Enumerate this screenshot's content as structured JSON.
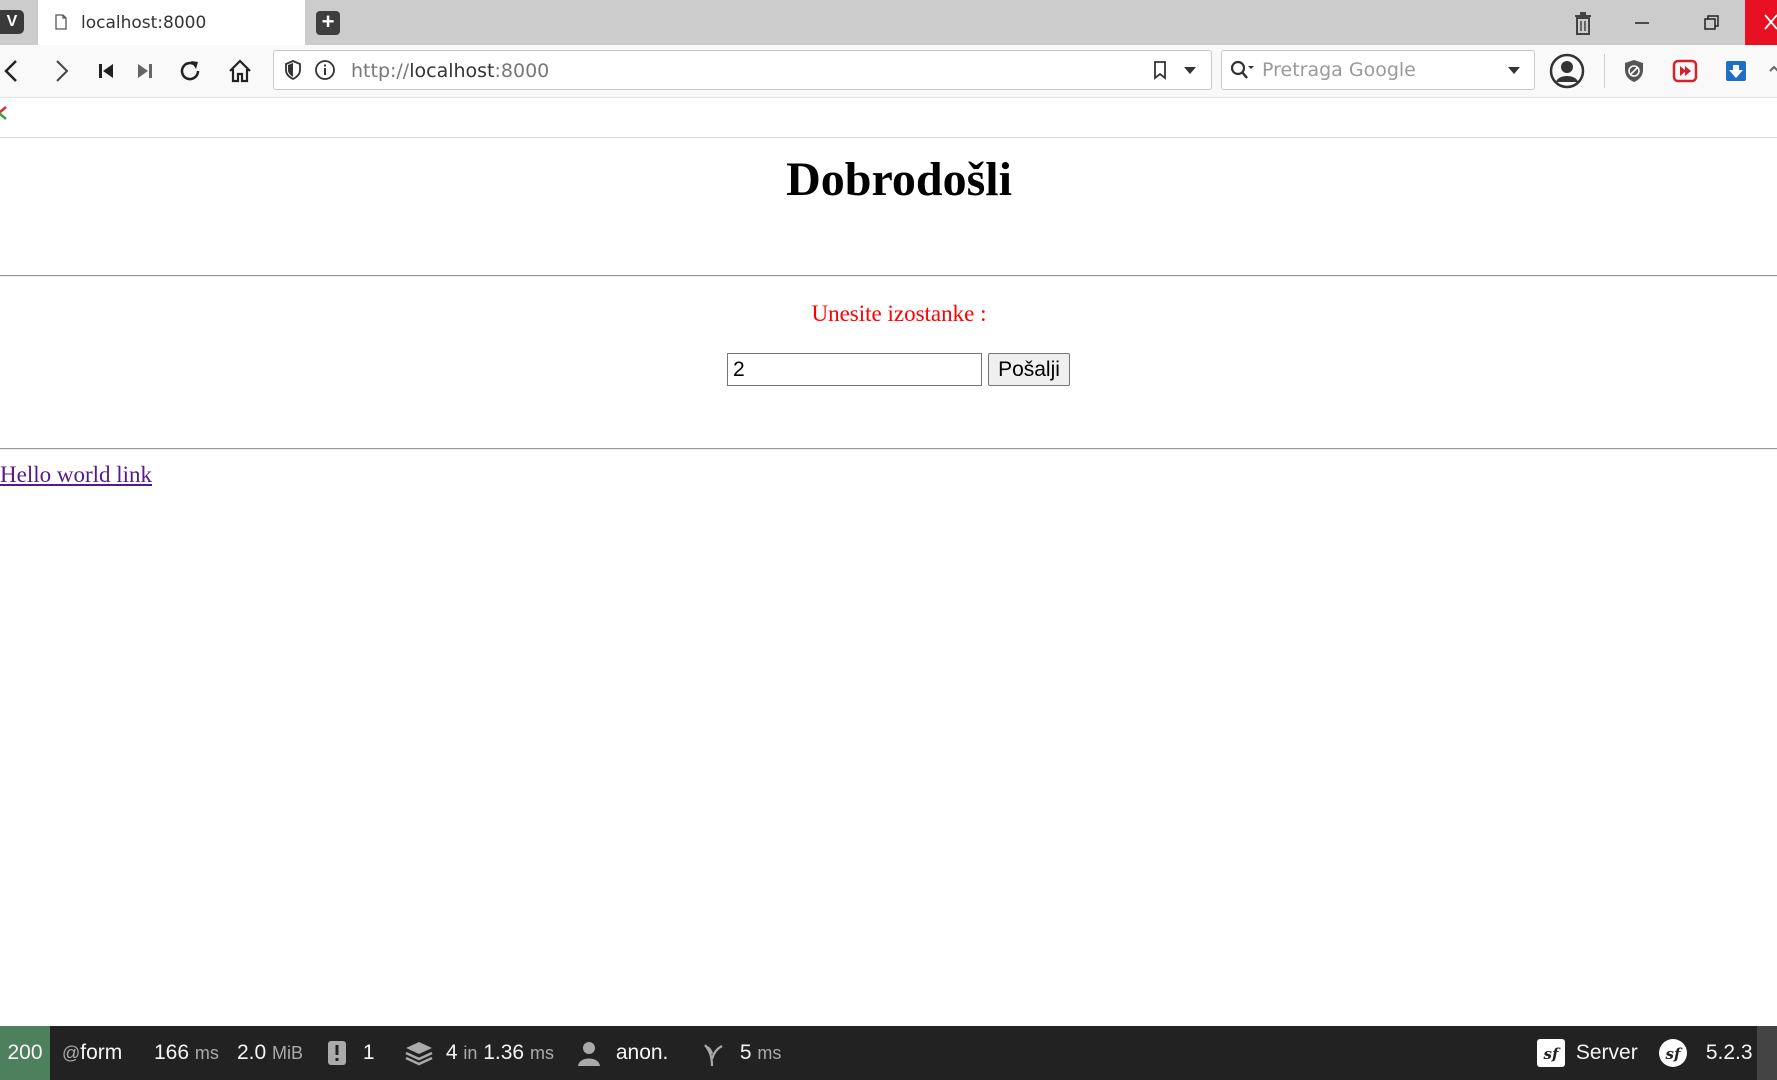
{
  "browser": {
    "tab_title": "localhost:8000",
    "url_scheme": "http://",
    "url_host": "localhost",
    "url_port": ":8000",
    "search_placeholder": "Pretraga Google"
  },
  "page": {
    "heading": "Dobrodošli",
    "prompt": "Unesite izostanke :",
    "input_value": "2",
    "submit_label": "Pošalji",
    "link_text": "Hello world link"
  },
  "debug_toolbar": {
    "status_code": "200",
    "route_prefix": "@",
    "route": "form",
    "time_value": "166",
    "time_unit": "ms",
    "memory_value": "2.0",
    "memory_unit": "MiB",
    "logs_count": "1",
    "cache_count": "4",
    "cache_in": "in",
    "cache_time": "1.36",
    "cache_unit": "ms",
    "user": "anon.",
    "twig_time": "5",
    "twig_unit": "ms",
    "server_label": "Server",
    "symfony_version": "5.2.3"
  }
}
